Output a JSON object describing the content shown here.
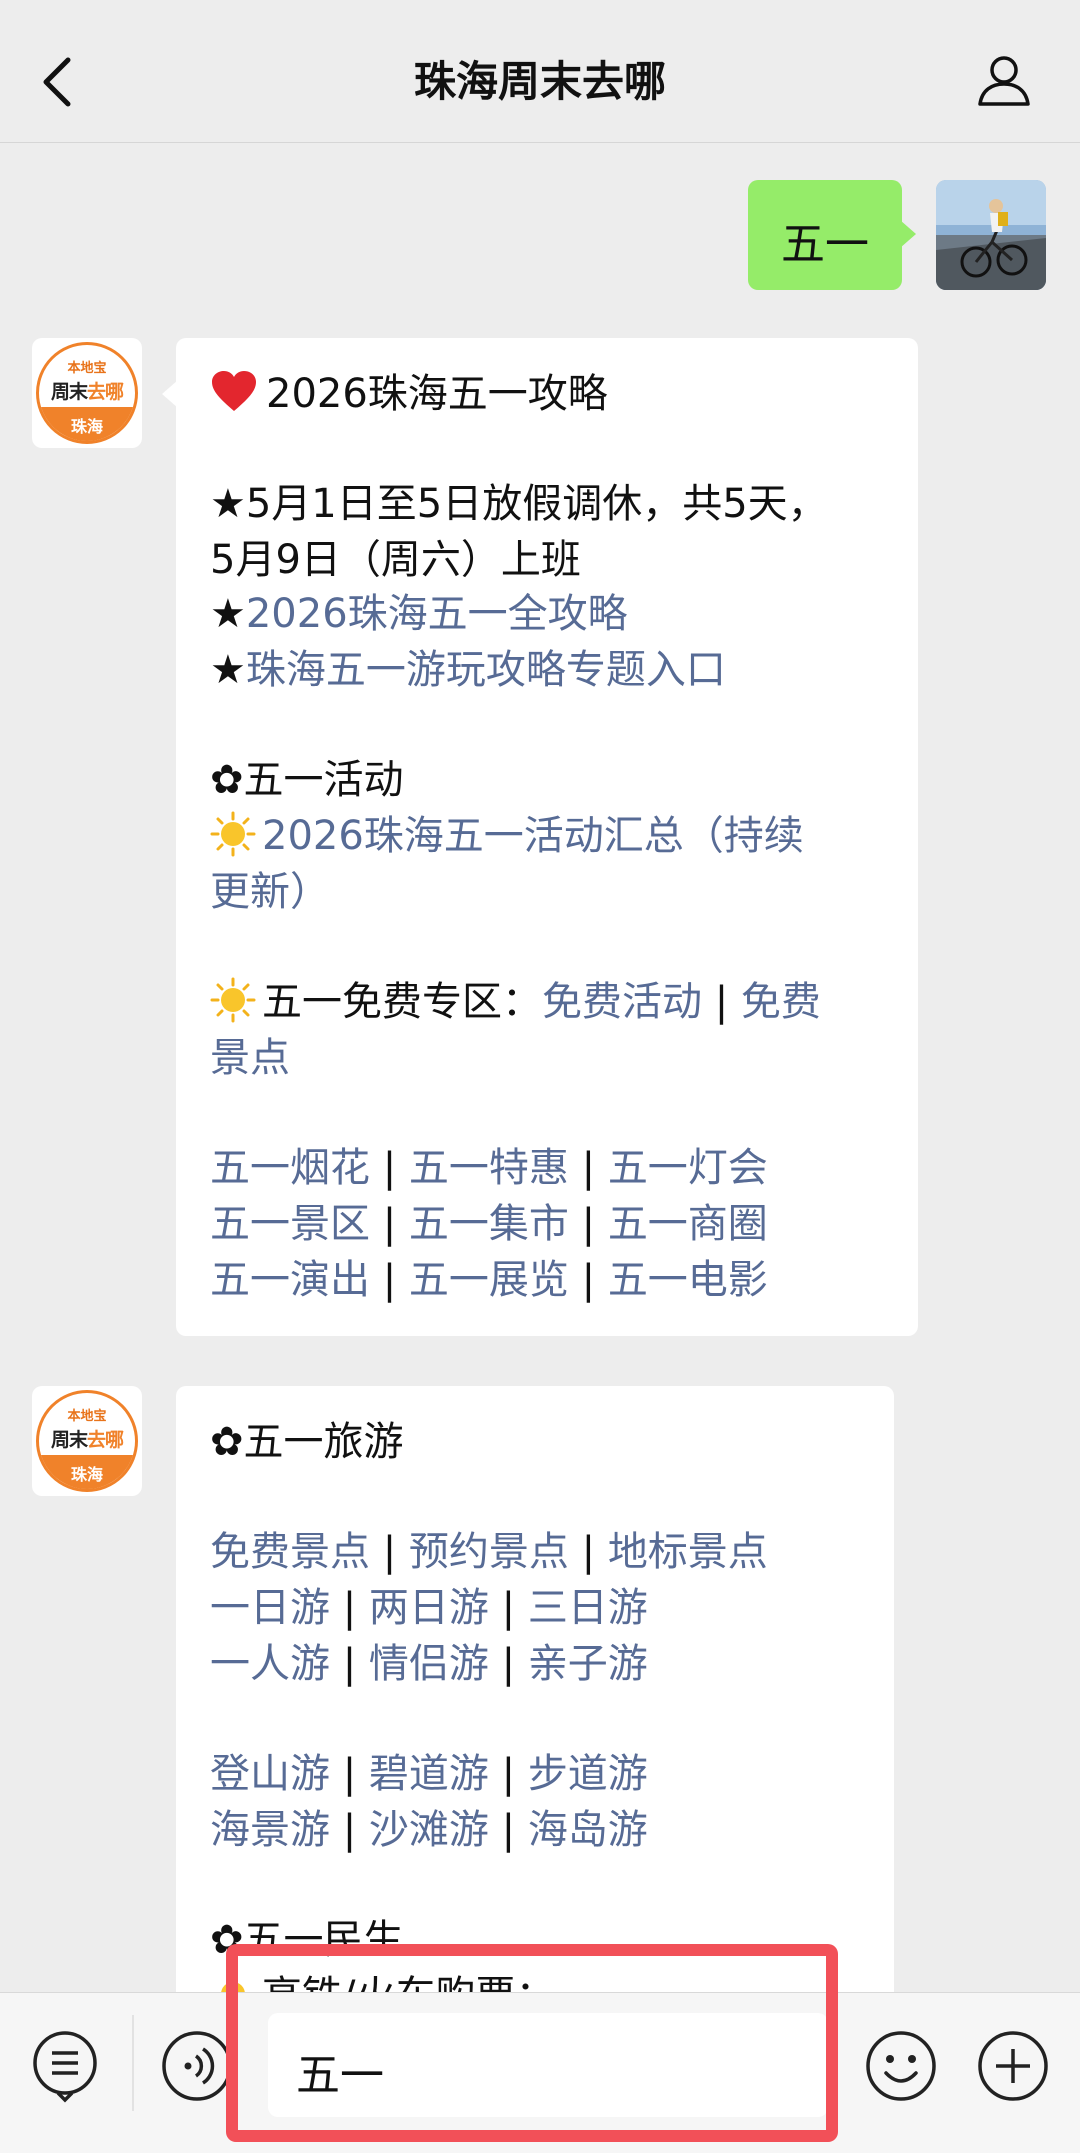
{
  "header": {
    "title": "珠海周末去哪"
  },
  "sent": {
    "text": "五一"
  },
  "account": {
    "badge_top": "本地宝",
    "name_black": "周末",
    "name_orange": "去哪",
    "city": "珠海"
  },
  "msg1": {
    "title": "2026珠海五一攻略",
    "holiday_line1": "★5月1日至5日放假调休，共5天，",
    "holiday_line2": "5月9日（周六）上班",
    "star": "★",
    "link_full_guide": "2026珠海五一全攻略",
    "link_topic": "珠海五一游玩攻略专题入口",
    "activities_header": "✿五一活动",
    "activities_link_line1": "2026珠海五一活动汇总（持续",
    "activities_link_line2": "更新）",
    "free_zone_label": "五一免费专区：",
    "free_activities": "免费活动",
    "free_spots_part1": "免费",
    "free_spots_part2": "景点",
    "sep": " | ",
    "grid": [
      [
        "五一烟花",
        "五一特惠",
        "五一灯会"
      ],
      [
        "五一景区",
        "五一集市",
        "五一商圈"
      ],
      [
        "五一演出",
        "五一展览",
        "五一电影"
      ]
    ]
  },
  "msg2": {
    "travel_header": "✿五一旅游",
    "row1": [
      "免费景点",
      "预约景点",
      "地标景点"
    ],
    "row2": [
      "一日游",
      "两日游",
      "三日游"
    ],
    "row3": [
      "一人游",
      "情侣游",
      "亲子游"
    ],
    "row4": [
      "登山游",
      "碧道游",
      "步道游"
    ],
    "row5": [
      "海景游",
      "沙滩游",
      "海岛游"
    ],
    "livelihood_header": "✿五一民生",
    "tickets_partial": "高铁/火车购票："
  },
  "input": {
    "text": "五一"
  },
  "colors": {
    "link": "#576b95",
    "sent_bubble": "#95ec69",
    "highlight": "#f25058",
    "brand_orange": "#f0822a"
  }
}
